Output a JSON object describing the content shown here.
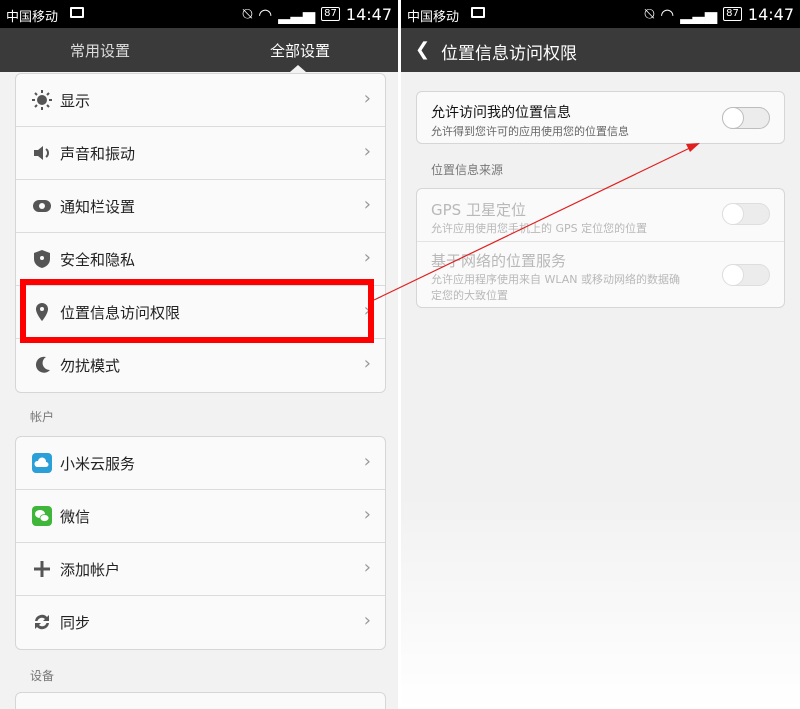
{
  "left": {
    "status": {
      "carrier": "中国移动",
      "battery": "87",
      "time": "14:47"
    },
    "tabs": [
      {
        "label": "常用设置"
      },
      {
        "label": "全部设置"
      }
    ],
    "group1": [
      {
        "label": "显示",
        "icon": "brightness-icon"
      },
      {
        "label": "声音和振动",
        "icon": "speaker-icon"
      },
      {
        "label": "通知栏设置",
        "icon": "notification-bar-icon"
      },
      {
        "label": "安全和隐私",
        "icon": "shield-icon"
      },
      {
        "label": "位置信息访问权限",
        "icon": "location-pin-icon"
      },
      {
        "label": "勿扰模式",
        "icon": "moon-icon"
      }
    ],
    "accounts_section": "帐户",
    "group2": [
      {
        "label": "小米云服务",
        "icon": "cloud-icon"
      },
      {
        "label": "微信",
        "icon": "wechat-icon"
      },
      {
        "label": "添加帐户",
        "icon": "plus-icon"
      },
      {
        "label": "同步",
        "icon": "sync-icon"
      }
    ],
    "device_section": "设备"
  },
  "right": {
    "status": {
      "carrier": "中国移动",
      "battery": "87",
      "time": "14:47"
    },
    "title": "位置信息访问权限",
    "allow": {
      "title": "允许访问我的位置信息",
      "subtitle": "允许得到您许可的应用使用您的位置信息",
      "enabled": false
    },
    "source_section": "位置信息来源",
    "gps": {
      "title": "GPS 卫星定位",
      "subtitle": "允许应用使用您手机上的 GPS 定位您的位置",
      "enabled": false
    },
    "network": {
      "title": "基于网络的位置服务",
      "subtitle_line1": "允许应用程序使用来自 WLAN 或移动网络的数据确",
      "subtitle_line2": "定您的大致位置",
      "enabled": false
    }
  },
  "colors": {
    "highlight": "#ff0000",
    "annotation_arrow": "#e0201f",
    "header": "#3a3a3a"
  }
}
